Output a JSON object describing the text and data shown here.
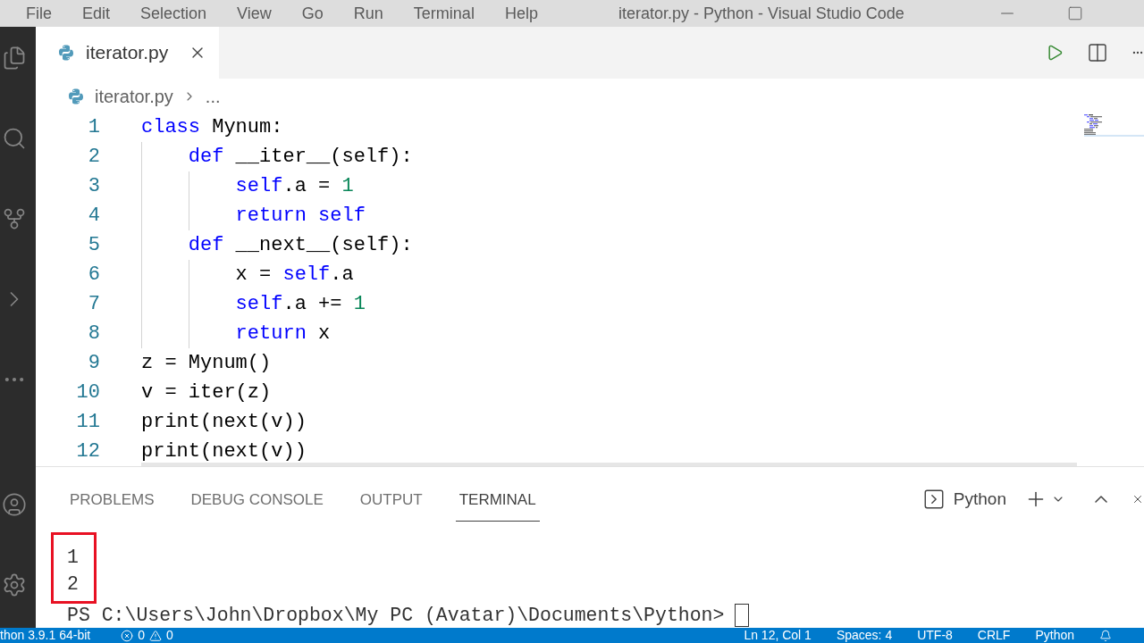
{
  "menu_bar": {
    "items": [
      "File",
      "Edit",
      "Selection",
      "View",
      "Go",
      "Run",
      "Terminal",
      "Help"
    ],
    "title": "iterator.py - Python - Visual Studio Code"
  },
  "editor_tabs": [
    {
      "label": "iterator.py",
      "selected": true
    }
  ],
  "breadcrumb": [
    "iterator.py",
    "..."
  ],
  "code": [
    {
      "number": "1",
      "tokens": [
        {
          "kind": "keyword",
          "text": "class"
        },
        {
          "kind": "plain",
          "text": " Mynum:"
        }
      ]
    },
    {
      "number": "2",
      "tokens": [
        {
          "kind": "keyword",
          "text": "    def"
        },
        {
          "kind": "plain",
          "text": " __iter__(self):"
        }
      ]
    },
    {
      "number": "3",
      "tokens": [
        {
          "kind": "keyword",
          "text": "        self"
        },
        {
          "kind": "plain",
          "text": ".a = "
        },
        {
          "kind": "number",
          "text": "1"
        }
      ]
    },
    {
      "number": "4",
      "tokens": [
        {
          "kind": "keyword",
          "text": "        return self"
        }
      ]
    },
    {
      "number": "5",
      "tokens": [
        {
          "kind": "keyword",
          "text": "    def"
        },
        {
          "kind": "plain",
          "text": " __next__(self):"
        }
      ]
    },
    {
      "number": "6",
      "tokens": [
        {
          "kind": "plain",
          "text": "        x = "
        },
        {
          "kind": "keyword",
          "text": "self"
        },
        {
          "kind": "plain",
          "text": ".a"
        }
      ]
    },
    {
      "number": "7",
      "tokens": [
        {
          "kind": "keyword",
          "text": "        self"
        },
        {
          "kind": "plain",
          "text": ".a += "
        },
        {
          "kind": "number",
          "text": "1"
        }
      ]
    },
    {
      "number": "8",
      "tokens": [
        {
          "kind": "keyword",
          "text": "        return"
        },
        {
          "kind": "plain",
          "text": " x"
        }
      ]
    },
    {
      "number": "9",
      "tokens": [
        {
          "kind": "plain",
          "text": "z = Mynum()"
        }
      ]
    },
    {
      "number": "10",
      "tokens": [
        {
          "kind": "plain",
          "text": "v = iter(z)"
        }
      ]
    },
    {
      "number": "11",
      "tokens": [
        {
          "kind": "plain",
          "text": "print(next(v))"
        }
      ]
    },
    {
      "number": "12",
      "tokens": [
        {
          "kind": "plain",
          "text": "print(next(v))"
        }
      ]
    }
  ],
  "panel": {
    "tabs": [
      {
        "label": "PROBLEMS",
        "selected": false
      },
      {
        "label": "DEBUG CONSOLE",
        "selected": false
      },
      {
        "label": "OUTPUT",
        "selected": false
      },
      {
        "label": "TERMINAL",
        "selected": true
      }
    ],
    "terminal_name": "Python"
  },
  "terminal": {
    "output": [
      "1",
      "2"
    ],
    "output_highlighted": true,
    "prompt": "PS C:\\Users\\John\\Dropbox\\My PC (Avatar)\\Documents\\Python>"
  },
  "status_bar": {
    "interpreter": "thon 3.9.1 64-bit",
    "errors": "0",
    "warnings": "0",
    "items": [
      "Ln 12, Col 1",
      "Spaces: 4",
      "UTF-8",
      "CRLF",
      "Python"
    ]
  }
}
